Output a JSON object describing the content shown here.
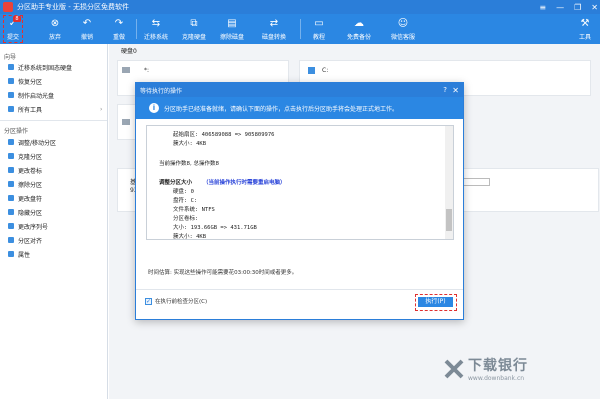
{
  "window": {
    "title": "分区助手专业版 - 无损分区免费软件",
    "controls": [
      "≡",
      "—",
      "❐",
      "✕"
    ]
  },
  "toolbar": {
    "commit": "提交",
    "discard": "放弃",
    "undo": "撤销",
    "redo": "重做",
    "migrate_system": "迁移系统",
    "clone_disk": "克隆硬盘",
    "wipe_disk": "擦除磁盘",
    "disk_convert": "磁盘转换",
    "tutorial": "教程",
    "free_backup": "免费备份",
    "wechat": "微信客服",
    "tools": "工具",
    "commit_badge": "8"
  },
  "sidebar": {
    "wizard_header": "向导",
    "wizard_items": [
      {
        "label": "迁移系统到固态硬盘",
        "icon": "migrate-icon"
      },
      {
        "label": "恢复分区",
        "icon": "recover-icon"
      },
      {
        "label": "制作启动光盘",
        "icon": "bootdisk-icon"
      },
      {
        "label": "所有工具",
        "icon": "tools-icon"
      }
    ],
    "ops_header": "分区操作",
    "ops_items": [
      {
        "label": "调整/移动分区",
        "icon": "resize-icon"
      },
      {
        "label": "克隆分区",
        "icon": "clone-icon"
      },
      {
        "label": "更改卷标",
        "icon": "label-icon"
      },
      {
        "label": "擦除分区",
        "icon": "wipe-icon"
      },
      {
        "label": "更改盘符",
        "icon": "drive-letter-icon"
      },
      {
        "label": "隐藏分区",
        "icon": "hide-icon"
      },
      {
        "label": "更改序列号",
        "icon": "serial-icon"
      },
      {
        "label": "分区对齐",
        "icon": "align-icon"
      },
      {
        "label": "属性",
        "icon": "properties-icon"
      }
    ]
  },
  "main": {
    "disk_label": "硬盘0",
    "partition_star": "*:",
    "partition_c": "C:",
    "row_label": "基",
    "row_value": "93"
  },
  "dialog": {
    "title": "等待执行的操作",
    "info": "分区助手已经准备就绪，请确认下面的操作，点击执行后分区助手将会处理正式地工作。",
    "ops": [
      {
        "text": "起始扇区:      406589088 => 905809976",
        "style": "mono"
      },
      {
        "text": "簇大小:        4KB",
        "style": "mono"
      },
      {
        "text": "当前操作数8, 总操作数8",
        "style": "plain"
      },
      {
        "text": "调整分区大小",
        "style": "bold"
      },
      {
        "text": "（当前操作执行时需要重启电脑）",
        "style": "hl"
      },
      {
        "text": "硬盘:          0",
        "style": "mono"
      },
      {
        "text": "盘符:          C:",
        "style": "mono"
      },
      {
        "text": "文件系统:      NTFS",
        "style": "mono"
      },
      {
        "text": "分区卷标:",
        "style": "mono"
      },
      {
        "text": "大小:          193.66GB => 431.71GB",
        "style": "mono"
      },
      {
        "text": "簇大小:        4KB",
        "style": "mono"
      }
    ],
    "time_estimate": "时间估算: 实现这些操作可能需要花03:00:30时间或者更多。",
    "checkbox_label": "在执行前检查分区(C)",
    "execute_button": "执行(P)",
    "help_glyph": "?",
    "close_glyph": "✕",
    "info_glyph": "i"
  },
  "watermark": {
    "title": "下载银行",
    "url": "www.downbank.cn"
  }
}
